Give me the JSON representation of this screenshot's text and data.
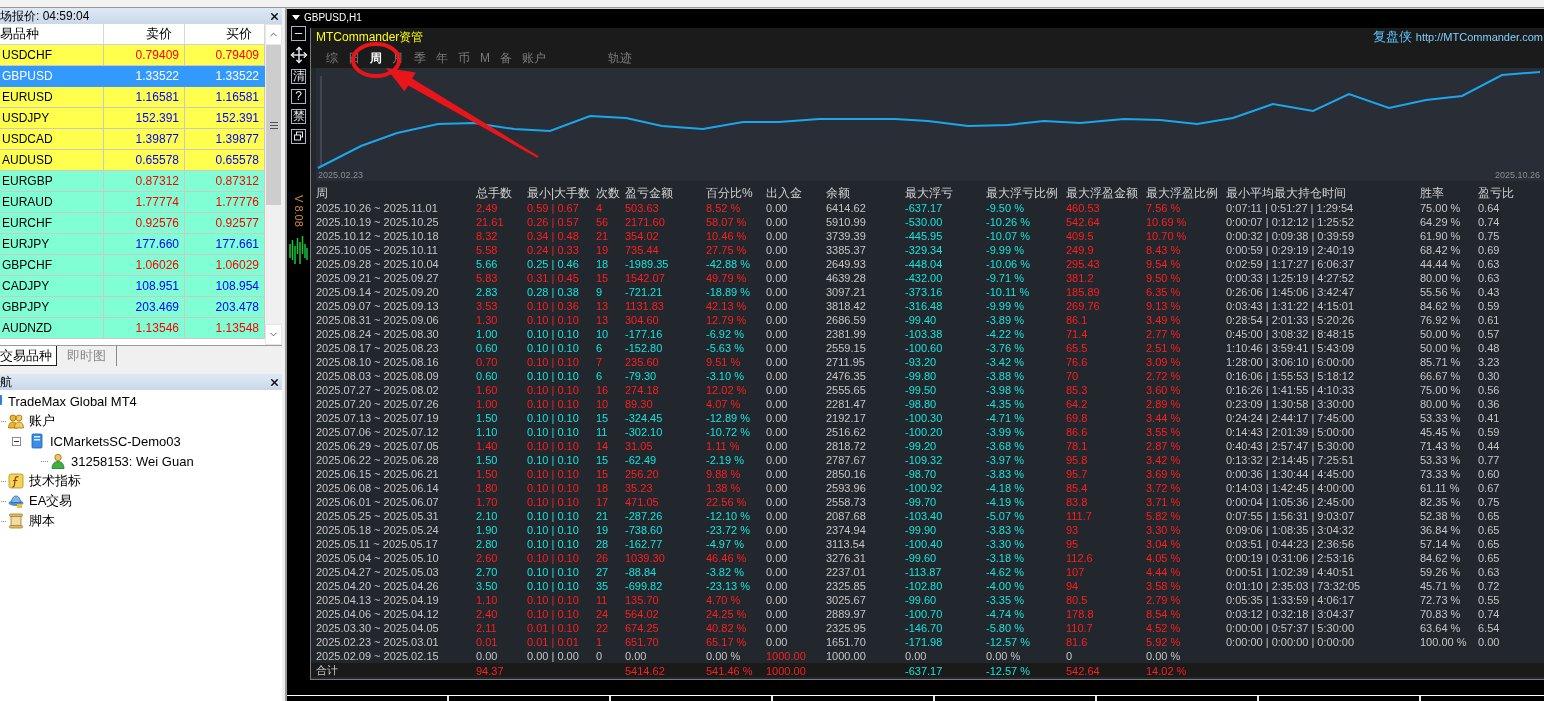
{
  "market_watch": {
    "title": "场报价: 04:59:04",
    "columns": [
      "易品种",
      "卖价",
      "买价"
    ],
    "rows": [
      {
        "symbol": "USDCHF",
        "bid": "0.79409",
        "ask": "0.79409",
        "color": "#ffff4d",
        "rising": false,
        "selected": false
      },
      {
        "symbol": "GBPUSD",
        "bid": "1.33522",
        "ask": "1.33522",
        "selected": true
      },
      {
        "symbol": "EURUSD",
        "bid": "1.16581",
        "ask": "1.16581",
        "color": "#ffff4d",
        "rising": true,
        "selected": false
      },
      {
        "symbol": "USDJPY",
        "bid": "152.391",
        "ask": "152.391",
        "color": "#ffff4d",
        "rising": true,
        "selected": false
      },
      {
        "symbol": "USDCAD",
        "bid": "1.39877",
        "ask": "1.39877",
        "color": "#ffff4d",
        "rising": true,
        "selected": false
      },
      {
        "symbol": "AUDUSD",
        "bid": "0.65578",
        "ask": "0.65578",
        "color": "#ffff4d",
        "rising": true,
        "selected": false
      },
      {
        "symbol": "EURGBP",
        "bid": "0.87312",
        "ask": "0.87312",
        "color": "#80ffd4",
        "rising": false,
        "selected": false
      },
      {
        "symbol": "EURAUD",
        "bid": "1.77774",
        "ask": "1.77776",
        "color": "#80ffd4",
        "rising": false,
        "selected": false
      },
      {
        "symbol": "EURCHF",
        "bid": "0.92576",
        "ask": "0.92577",
        "color": "#80ffd4",
        "rising": false,
        "selected": false
      },
      {
        "symbol": "EURJPY",
        "bid": "177.660",
        "ask": "177.661",
        "color": "#80ffd4",
        "rising": true,
        "selected": false
      },
      {
        "symbol": "GBPCHF",
        "bid": "1.06026",
        "ask": "1.06029",
        "color": "#80ffd4",
        "rising": false,
        "selected": false
      },
      {
        "symbol": "CADJPY",
        "bid": "108.951",
        "ask": "108.954",
        "color": "#80ffd4",
        "rising": true,
        "selected": false
      },
      {
        "symbol": "GBPJPY",
        "bid": "203.469",
        "ask": "203.478",
        "color": "#80ffd4",
        "rising": true,
        "selected": false
      },
      {
        "symbol": "AUDNZD",
        "bid": "1.13546",
        "ask": "1.13548",
        "color": "#80ffd4",
        "rising": false,
        "selected": false
      }
    ],
    "tabs": [
      {
        "label": "交易品种",
        "selected": true
      },
      {
        "label": "即时图",
        "selected": false
      }
    ]
  },
  "navigator": {
    "title": "航",
    "tree": [
      {
        "label": "TradeMax Global MT4",
        "kind": "terminal",
        "children": [
          {
            "label": "账户",
            "kind": "accounts",
            "children": [
              {
                "label": "ICMarketsSC-Demo03",
                "kind": "server",
                "expanded": true,
                "children": [
                  {
                    "label": "31258153: Wei Guan",
                    "kind": "user"
                  }
                ]
              }
            ]
          },
          {
            "label": "技术指标",
            "kind": "indicators"
          },
          {
            "label": "EA交易",
            "kind": "experts"
          },
          {
            "label": "脚本",
            "kind": "scripts"
          }
        ]
      }
    ]
  },
  "chart_window": {
    "title": "GBPUSD,H1",
    "side_buttons": [
      {
        "kind": "minimize"
      },
      {
        "kind": "move"
      },
      {
        "kind": "text",
        "label": "清"
      },
      {
        "kind": "text",
        "label": "?"
      },
      {
        "kind": "text",
        "label": "禁"
      },
      {
        "kind": "restore"
      }
    ],
    "version": "V 8.08"
  },
  "commander": {
    "title": "MTCommander资管",
    "brand": "复盘侠",
    "link": "http://MTCommander.com",
    "tabs": [
      {
        "label": "综",
        "selected": false
      },
      {
        "label": "日",
        "selected": false
      },
      {
        "label": "周",
        "selected": true
      },
      {
        "label": "月",
        "selected": false
      },
      {
        "label": "季",
        "selected": false
      },
      {
        "label": "年",
        "selected": false
      },
      {
        "label": "币",
        "selected": false
      },
      {
        "label": "M",
        "selected": false
      },
      {
        "label": "备",
        "selected": false
      },
      {
        "label": "账户",
        "selected": false
      }
    ],
    "side_tabs": [
      {
        "label": "轨迹",
        "selected": false
      }
    ],
    "equity_chart": {
      "start_label": "2025.02.23",
      "end_label": "2025.10.26"
    },
    "table": {
      "columns": [
        {
          "label": "周",
          "kind": "plain"
        },
        {
          "label": "总手数",
          "kind": "result"
        },
        {
          "label": "最小|大手数",
          "kind": "result"
        },
        {
          "label": "次数",
          "kind": "result"
        },
        {
          "label": "盈亏金额",
          "kind": "result"
        },
        {
          "label": "百分比%",
          "kind": "result"
        },
        {
          "label": "出入金",
          "kind": "flow"
        },
        {
          "label": "余额",
          "kind": "plain"
        },
        {
          "label": "最大浮亏",
          "kind": "drawdown"
        },
        {
          "label": "最大浮亏比例",
          "kind": "drawdown"
        },
        {
          "label": "最大浮盈金额",
          "kind": "runup"
        },
        {
          "label": "最大浮盈比例",
          "kind": "runup"
        },
        {
          "label": "最小平均最大持仓时间",
          "kind": "plain"
        },
        {
          "label": "胜率",
          "kind": "plain"
        },
        {
          "label": "盈亏比",
          "kind": "plain"
        }
      ],
      "rows": [
        {
          "kind": "profit",
          "cells": [
            "2025.10.26 ~ 2025.11.01",
            "2.49",
            "0.59 | 0.67",
            "4",
            "503.63",
            "8.52 %",
            "0.00",
            "6414.62",
            "-637.17",
            "-9.50 %",
            "460.53",
            "7.56 %",
            "0:07:11 | 0:51:27 | 1:29:54",
            "75.00 %",
            "0.64"
          ]
        },
        {
          "kind": "profit",
          "cells": [
            "2025.10.19 ~ 2025.10.25",
            "21.61",
            "0.26 | 0.57",
            "56",
            "2171.60",
            "58.07 %",
            "0.00",
            "5910.99",
            "-530.00",
            "-10.26 %",
            "542.64",
            "10.69 %",
            "0:00:07 | 0:12:12 | 1:25:52",
            "64.29 %",
            "0.74"
          ]
        },
        {
          "kind": "profit",
          "cells": [
            "2025.10.12 ~ 2025.10.18",
            "8.32",
            "0.34 | 0.48",
            "21",
            "354.02",
            "10.46 %",
            "0.00",
            "3739.39",
            "-445.95",
            "-10.07 %",
            "409.5",
            "10.70 %",
            "0:00:32 | 0:09:38 | 0:39:59",
            "61.90 %",
            "0.75"
          ]
        },
        {
          "kind": "profit",
          "cells": [
            "2025.10.05 ~ 2025.10.11",
            "5.58",
            "0.24 | 0.33",
            "19",
            "735.44",
            "27.75 %",
            "0.00",
            "3385.37",
            "-329.34",
            "-9.99 %",
            "249.9",
            "8.43 %",
            "0:00:59 | 0:29:19 | 2:40:19",
            "68.42 %",
            "0.69"
          ]
        },
        {
          "kind": "loss",
          "cells": [
            "2025.09.28 ~ 2025.10.04",
            "5.66",
            "0.25 | 0.46",
            "18",
            "-1989.35",
            "-42.88 %",
            "0.00",
            "2649.93",
            "-448.04",
            "-10.06 %",
            "295.43",
            "9.54 %",
            "0:02:59 | 1:17:27 | 6:06:37",
            "44.44 %",
            "0.63"
          ]
        },
        {
          "kind": "profit",
          "cells": [
            "2025.09.21 ~ 2025.09.27",
            "5.83",
            "0.31 | 0.45",
            "15",
            "1542.07",
            "49.79 %",
            "0.00",
            "4639.28",
            "-432.00",
            "-9.71 %",
            "381.2",
            "9.50 %",
            "0:00:33 | 1:25:19 | 4:27:52",
            "80.00 %",
            "0.63"
          ]
        },
        {
          "kind": "loss",
          "cells": [
            "2025.09.14 ~ 2025.09.20",
            "2.83",
            "0.28 | 0.38",
            "9",
            "-721.21",
            "-18.89 %",
            "0.00",
            "3097.21",
            "-373.16",
            "-10.11 %",
            "185.89",
            "6.35 %",
            "0:26:06 | 1:45:06 | 3:42:47",
            "55.56 %",
            "0.43"
          ]
        },
        {
          "kind": "profit",
          "cells": [
            "2025.09.07 ~ 2025.09.13",
            "3.53",
            "0.10 | 0.36",
            "13",
            "1131.83",
            "42.13 %",
            "0.00",
            "3818.42",
            "-316.48",
            "-9.99 %",
            "269.76",
            "9.13 %",
            "0:03:43 | 1:31:22 | 4:15:01",
            "84.62 %",
            "0.59"
          ]
        },
        {
          "kind": "profit",
          "cells": [
            "2025.08.31 ~ 2025.09.06",
            "1.30",
            "0.10 | 0.10",
            "13",
            "304.60",
            "12.79 %",
            "0.00",
            "2686.59",
            "-99.40",
            "-3.89 %",
            "86.1",
            "3.49 %",
            "0:28:54 | 2:01:33 | 5:20:26",
            "76.92 %",
            "0.61"
          ]
        },
        {
          "kind": "loss",
          "cells": [
            "2025.08.24 ~ 2025.08.30",
            "1.00",
            "0.10 | 0.10",
            "10",
            "-177.16",
            "-6.92 %",
            "0.00",
            "2381.99",
            "-103.38",
            "-4.22 %",
            "71.4",
            "2.77 %",
            "0:45:00 | 3:08:32 | 8:48:15",
            "50.00 %",
            "0.57"
          ]
        },
        {
          "kind": "loss",
          "cells": [
            "2025.08.17 ~ 2025.08.23",
            "0.60",
            "0.10 | 0.10",
            "6",
            "-152.80",
            "-5.63 %",
            "0.00",
            "2559.15",
            "-100.60",
            "-3.76 %",
            "65.5",
            "2.51 %",
            "1:10:46 | 3:59:41 | 5:43:09",
            "50.00 %",
            "0.48"
          ]
        },
        {
          "kind": "profit",
          "cells": [
            "2025.08.10 ~ 2025.08.16",
            "0.70",
            "0.10 | 0.10",
            "7",
            "235.60",
            "9.51 %",
            "0.00",
            "2711.95",
            "-93.20",
            "-3.42 %",
            "76.6",
            "3.09 %",
            "1:28:00 | 3:06:10 | 6:00:00",
            "85.71 %",
            "3.23"
          ]
        },
        {
          "kind": "loss",
          "cells": [
            "2025.08.03 ~ 2025.08.09",
            "0.60",
            "0.10 | 0.10",
            "6",
            "-79.30",
            "-3.10 %",
            "0.00",
            "2476.35",
            "-99.80",
            "-3.88 %",
            "70",
            "2.72 %",
            "0:16:06 | 1:55:53 | 5:18:12",
            "66.67 %",
            "0.30"
          ]
        },
        {
          "kind": "profit",
          "cells": [
            "2025.07.27 ~ 2025.08.02",
            "1.60",
            "0.10 | 0.10",
            "16",
            "274.18",
            "12.02 %",
            "0.00",
            "2555.65",
            "-99.50",
            "-3.98 %",
            "85.3",
            "3.60 %",
            "0:16:26 | 1:41:55 | 4:10:33",
            "75.00 %",
            "0.56"
          ]
        },
        {
          "kind": "profit",
          "cells": [
            "2025.07.20 ~ 2025.07.26",
            "1.00",
            "0.10 | 0.10",
            "10",
            "89.30",
            "4.07 %",
            "0.00",
            "2281.47",
            "-98.80",
            "-4.35 %",
            "64.2",
            "2.89 %",
            "0:23:09 | 1:30:58 | 3:30:00",
            "80.00 %",
            "0.36"
          ]
        },
        {
          "kind": "loss",
          "cells": [
            "2025.07.13 ~ 2025.07.19",
            "1.50",
            "0.10 | 0.10",
            "15",
            "-324.45",
            "-12.89 %",
            "0.00",
            "2192.17",
            "-100.30",
            "-4.71 %",
            "69.8",
            "3.44 %",
            "0:24:24 | 2:44:17 | 7:45:00",
            "53.33 %",
            "0.41"
          ]
        },
        {
          "kind": "loss",
          "cells": [
            "2025.07.06 ~ 2025.07.12",
            "1.10",
            "0.10 | 0.10",
            "11",
            "-302.10",
            "-10.72 %",
            "0.00",
            "2516.62",
            "-100.20",
            "-3.99 %",
            "86.6",
            "3.55 %",
            "0:14:43 | 2:01:39 | 5:00:00",
            "45.45 %",
            "0.59"
          ]
        },
        {
          "kind": "profit",
          "cells": [
            "2025.06.29 ~ 2025.07.05",
            "1.40",
            "0.10 | 0.10",
            "14",
            "31.05",
            "1.11 %",
            "0.00",
            "2818.72",
            "-99.20",
            "-3.68 %",
            "78.1",
            "2.87 %",
            "0:40:43 | 2:57:47 | 5:30:00",
            "71.43 %",
            "0.44"
          ]
        },
        {
          "kind": "loss",
          "cells": [
            "2025.06.22 ~ 2025.06.28",
            "1.50",
            "0.10 | 0.10",
            "15",
            "-62.49",
            "-2.19 %",
            "0.00",
            "2787.67",
            "-109.32",
            "-3.97 %",
            "95.8",
            "3.42 %",
            "0:13:32 | 2:14:45 | 7:25:51",
            "53.33 %",
            "0.77"
          ]
        },
        {
          "kind": "profit",
          "cells": [
            "2025.06.15 ~ 2025.06.21",
            "1.50",
            "0.10 | 0.10",
            "15",
            "256.20",
            "9.88 %",
            "0.00",
            "2850.16",
            "-98.70",
            "-3.83 %",
            "95.7",
            "3.69 %",
            "0:00:36 | 1:30:44 | 4:45:00",
            "73.33 %",
            "0.60"
          ]
        },
        {
          "kind": "profit",
          "cells": [
            "2025.06.08 ~ 2025.06.14",
            "1.80",
            "0.10 | 0.10",
            "18",
            "35.23",
            "1.38 %",
            "0.00",
            "2593.96",
            "-100.92",
            "-4.18 %",
            "85.4",
            "3.72 %",
            "0:14:03 | 1:42:45 | 4:00:00",
            "61.11 %",
            "0.67"
          ]
        },
        {
          "kind": "profit",
          "cells": [
            "2025.06.01 ~ 2025.06.07",
            "1.70",
            "0.10 | 0.10",
            "17",
            "471.05",
            "22.56 %",
            "0.00",
            "2558.73",
            "-99.70",
            "-4.19 %",
            "83.8",
            "3.71 %",
            "0:00:04 | 1:05:36 | 2:45:00",
            "82.35 %",
            "0.75"
          ]
        },
        {
          "kind": "loss",
          "cells": [
            "2025.05.25 ~ 2025.05.31",
            "2.10",
            "0.10 | 0.10",
            "21",
            "-287.26",
            "-12.10 %",
            "0.00",
            "2087.68",
            "-103.40",
            "-5.07 %",
            "111.7",
            "5.82 %",
            "0:07:55 | 1:56:31 | 9:03:07",
            "52.38 %",
            "0.65"
          ]
        },
        {
          "kind": "loss",
          "cells": [
            "2025.05.18 ~ 2025.05.24",
            "1.90",
            "0.10 | 0.10",
            "19",
            "-738.60",
            "-23.72 %",
            "0.00",
            "2374.94",
            "-99.90",
            "-3.83 %",
            "93",
            "3.30 %",
            "0:09:06 | 1:08:35 | 3:04:32",
            "36.84 %",
            "0.65"
          ]
        },
        {
          "kind": "loss",
          "cells": [
            "2025.05.11 ~ 2025.05.17",
            "2.80",
            "0.10 | 0.10",
            "28",
            "-162.77",
            "-4.97 %",
            "0.00",
            "3113.54",
            "-100.40",
            "-3.30 %",
            "95",
            "3.04 %",
            "0:03:51 | 0:44:23 | 2:36:56",
            "57.14 %",
            "0.65"
          ]
        },
        {
          "kind": "profit",
          "cells": [
            "2025.05.04 ~ 2025.05.10",
            "2.60",
            "0.10 | 0.10",
            "26",
            "1039.30",
            "46.46 %",
            "0.00",
            "3276.31",
            "-99.60",
            "-3.18 %",
            "112.6",
            "4.05 %",
            "0:00:19 | 0:31:06 | 2:53:16",
            "84.62 %",
            "0.65"
          ]
        },
        {
          "kind": "loss",
          "cells": [
            "2025.04.27 ~ 2025.05.03",
            "2.70",
            "0.10 | 0.10",
            "27",
            "-88.84",
            "-3.82 %",
            "0.00",
            "2237.01",
            "-113.87",
            "-4.62 %",
            "107",
            "4.44 %",
            "0:00:51 | 1:02:39 | 4:40:51",
            "59.26 %",
            "0.63"
          ]
        },
        {
          "kind": "loss",
          "cells": [
            "2025.04.20 ~ 2025.04.26",
            "3.50",
            "0.10 | 0.10",
            "35",
            "-699.82",
            "-23.13 %",
            "0.00",
            "2325.85",
            "-102.80",
            "-4.00 %",
            "94",
            "3.58 %",
            "0:01:10 | 2:35:03 | 73:32:05",
            "45.71 %",
            "0.72"
          ]
        },
        {
          "kind": "profit",
          "cells": [
            "2025.04.13 ~ 2025.04.19",
            "1.10",
            "0.10 | 0.10",
            "11",
            "135.70",
            "4.70 %",
            "0.00",
            "3025.67",
            "-99.60",
            "-3.35 %",
            "80.5",
            "2.79 %",
            "0:05:35 | 1:33:59 | 4:06:17",
            "72.73 %",
            "0.55"
          ]
        },
        {
          "kind": "profit",
          "cells": [
            "2025.04.06 ~ 2025.04.12",
            "2.40",
            "0.10 | 0.10",
            "24",
            "564.02",
            "24.25 %",
            "0.00",
            "2889.97",
            "-100.70",
            "-4.74 %",
            "178.8",
            "8.54 %",
            "0:03:12 | 0:32:18 | 3:04:37",
            "70.83 %",
            "0.74"
          ]
        },
        {
          "kind": "profit",
          "cells": [
            "2025.03.30 ~ 2025.04.05",
            "2.11",
            "0.01 | 0.10",
            "22",
            "674.25",
            "40.82 %",
            "0.00",
            "2325.95",
            "-146.70",
            "-5.80 %",
            "110.7",
            "4.52 %",
            "0:00:00 | 0:57:37 | 5:30:00",
            "63.64 %",
            "6.54"
          ]
        },
        {
          "kind": "profit",
          "cells": [
            "2025.02.23 ~ 2025.03.01",
            "0.01",
            "0.01 | 0.01",
            "1",
            "651.70",
            "65.17 %",
            "0.00",
            "1651.70",
            "-171.98",
            "-12.57 %",
            "81.6",
            "5.92 %",
            "0:00:00 | 0:00:00 | 0:00:00",
            "100.00 %",
            "0.00"
          ]
        },
        {
          "kind": "deposit",
          "cells": [
            "2025.02.09 ~ 2025.02.15",
            "0.00",
            "0.00 | 0.00",
            "0",
            "0.00",
            "0.00 %",
            "1000.00",
            "1000.00",
            "0.00",
            "0.00 %",
            "0",
            "0.00 %"
          ]
        }
      ],
      "total": {
        "kind": "total",
        "cells": [
          "合计",
          "94.37",
          null,
          null,
          "5414.62",
          "541.46 %",
          "1000.00",
          null,
          "-637.17",
          "-12.57 %",
          "542.64",
          "14.02 %"
        ]
      }
    }
  }
}
